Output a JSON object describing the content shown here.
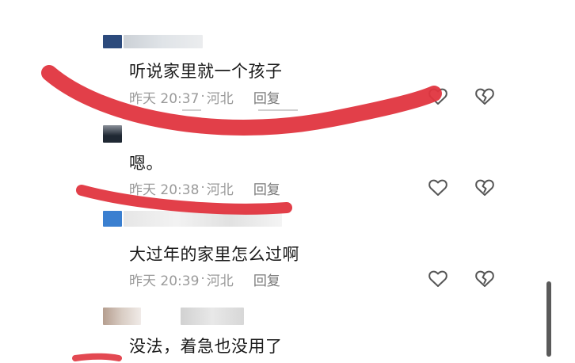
{
  "comments": [
    {
      "text": "听说家里就一个孩子",
      "time": "昨天 20:37",
      "separator": "·",
      "location": "河北",
      "reply_label": "回复",
      "like_icon": "heart-outline-icon",
      "dislike_icon": "broken-heart-icon"
    },
    {
      "text": "嗯。",
      "time": "昨天 20:38",
      "separator": "·",
      "location": "河北",
      "reply_label": "回复",
      "like_icon": "heart-outline-icon",
      "dislike_icon": "broken-heart-icon"
    },
    {
      "text": "大过年的家里怎么过啊",
      "time": "昨天 20:39",
      "separator": "·",
      "location": "河北",
      "reply_label": "回复",
      "like_icon": "heart-outline-icon",
      "dislike_icon": "broken-heart-icon"
    },
    {
      "text": "没法，着急也没用了"
    }
  ],
  "colors": {
    "scribble": "#e0353f",
    "meta_text": "#9a9a9a",
    "body_text": "#1a1a1a",
    "icon_stroke": "#555555"
  }
}
